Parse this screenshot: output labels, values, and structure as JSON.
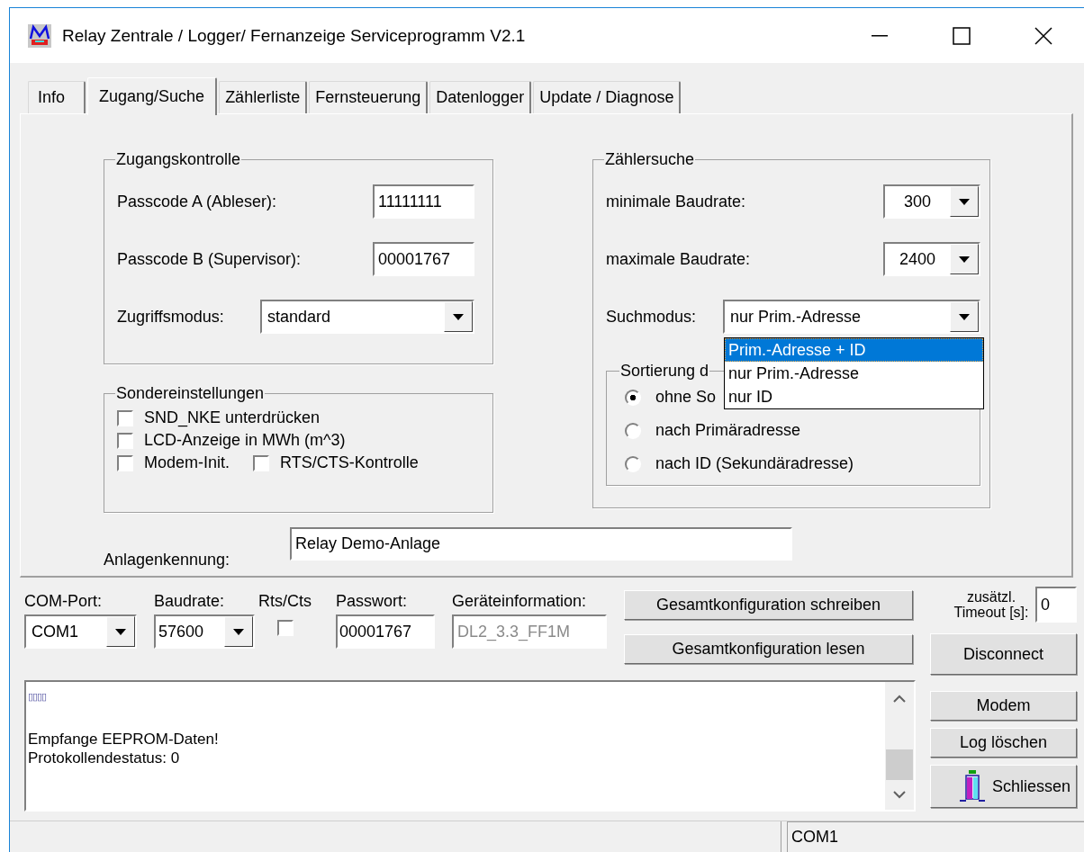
{
  "window": {
    "title": "Relay Zentrale / Logger/ Fernanzeige Serviceprogramm  V2.1"
  },
  "tabs": [
    {
      "label": "Info",
      "selected": false
    },
    {
      "label": "Zugang/Suche",
      "selected": true
    },
    {
      "label": "Zählerliste",
      "selected": false
    },
    {
      "label": "Fernsteuerung",
      "selected": false
    },
    {
      "label": "Datenlogger",
      "selected": false
    },
    {
      "label": "Update / Diagnose",
      "selected": false
    }
  ],
  "access_control": {
    "title": "Zugangskontrolle",
    "fields": [
      {
        "label": "Passcode A (Ableser):",
        "value": "11111111"
      },
      {
        "label": "Passcode B (Supervisor):",
        "value": "00001767"
      }
    ],
    "mode": {
      "label": "Zugriffsmodus:",
      "value": "standard"
    }
  },
  "special_settings": {
    "title": "Sondereinstellungen",
    "options": [
      {
        "label": "SND_NKE unterdrücken",
        "checked": false
      },
      {
        "label": "LCD-Anzeige in MWh (m^3)",
        "checked": false
      },
      {
        "label": "Modem-Init.",
        "checked": false
      },
      {
        "label": "RTS/CTS-Kontrolle",
        "checked": false
      }
    ]
  },
  "meter_search": {
    "title": "Zählersuche",
    "min_baud": {
      "label": "minimale Baudrate:",
      "value": "300"
    },
    "max_baud": {
      "label": "maximale Baudrate:",
      "value": "2400"
    },
    "search_mode": {
      "label": "Suchmodus:",
      "value": "nur Prim.-Adresse",
      "expanded": true,
      "options": [
        {
          "label": "Prim.-Adresse + ID",
          "highlighted": true
        },
        {
          "label": "nur Prim.-Adresse",
          "highlighted": false
        },
        {
          "label": "nur ID",
          "highlighted": false
        }
      ]
    },
    "sorting": {
      "title": "Sortierung d",
      "options": [
        {
          "label": "ohne So",
          "selected": true
        },
        {
          "label": "nach Primäradresse",
          "selected": false
        },
        {
          "label": "nach ID (Sekundäradresse)",
          "selected": false
        }
      ]
    }
  },
  "plant_id": {
    "label": "Anlagenkennung:",
    "value": "Relay Demo-Anlage"
  },
  "connection": {
    "com_port": {
      "label": "COM-Port:",
      "value": "COM1"
    },
    "baud": {
      "label": "Baudrate:",
      "value": "57600"
    },
    "rts_cts": {
      "label": "Rts/Cts",
      "checked": false
    },
    "password": {
      "label": "Passwort:",
      "value": "00001767"
    },
    "device_info": {
      "label": "Geräteinformation:",
      "value": "DL2_3.3_FF1M",
      "disabled": true
    }
  },
  "config_buttons": [
    "Gesamtkonfiguration schreiben",
    "Gesamtkonfiguration lesen"
  ],
  "timeout": {
    "label": "zusätzl. Timeout [s]:",
    "value": "0"
  },
  "side_buttons": [
    {
      "label": "Disconnect",
      "kind": "tall"
    },
    {
      "label": "Modem",
      "kind": "plain"
    },
    {
      "label": "Log löschen",
      "kind": "plain"
    },
    {
      "label": "Schliessen",
      "kind": "exit"
    }
  ],
  "log": {
    "marker": "▯▯▯▯",
    "lines": [
      "Empfange EEPROM-Daten!",
      "Protokollendestatus: 0"
    ]
  },
  "status_bar": {
    "panels": [
      "COM1"
    ]
  }
}
